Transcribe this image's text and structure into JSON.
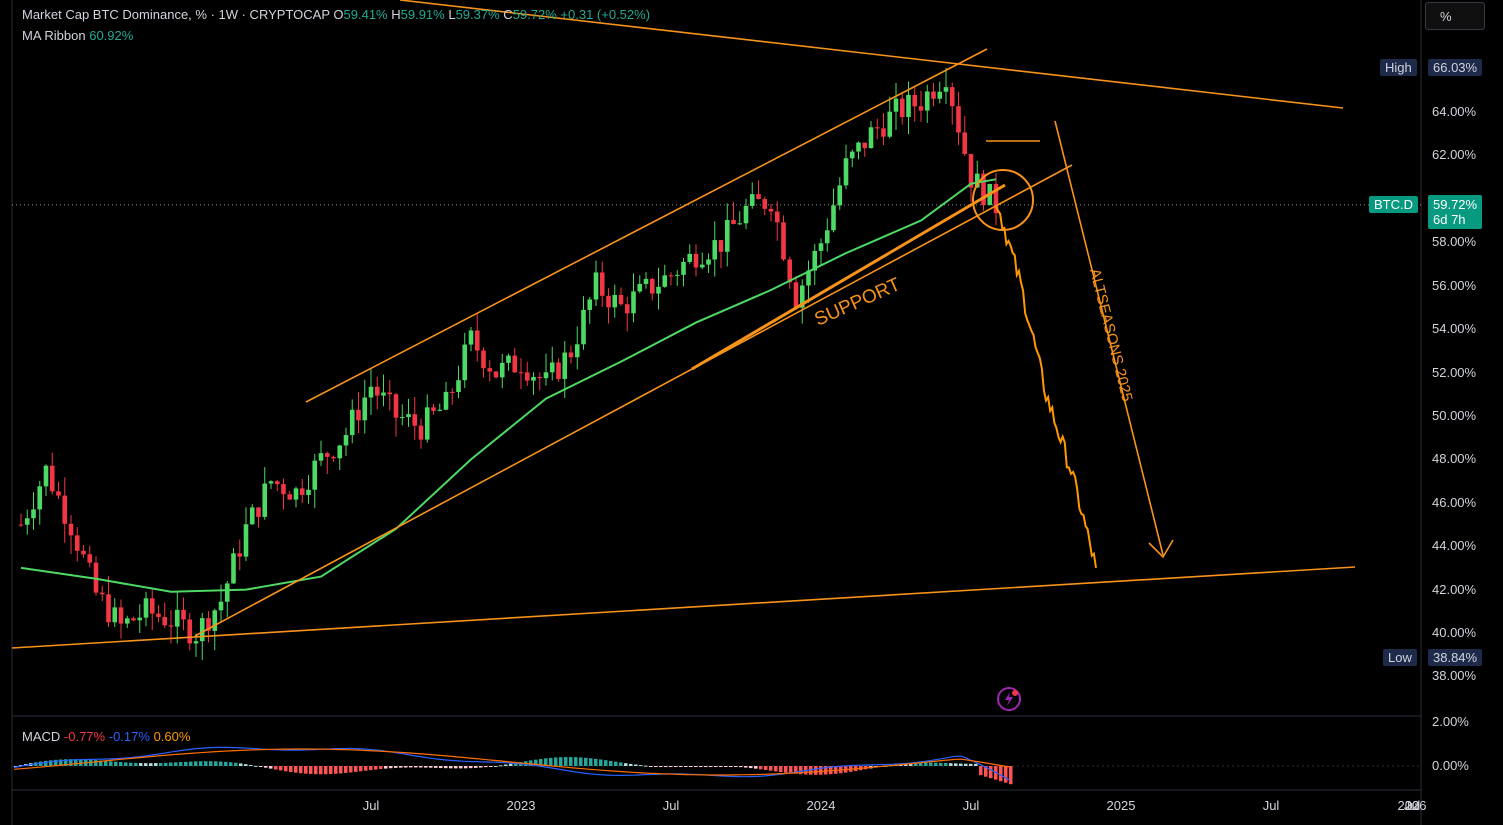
{
  "legend": {
    "title": "Market Cap BTC Dominance, % · 1W · CRYPTOCAP",
    "o_label": "O",
    "o_value": "59.41%",
    "h_label": "H",
    "h_value": "59.91%",
    "l_label": "L",
    "l_value": "59.37%",
    "c_label": "C",
    "c_value": "59.72%",
    "change": "+0.31 (+0.52%)",
    "ma_label": "MA Ribbon",
    "ma_value": "60.92%"
  },
  "scale_button": "%",
  "price_tags": {
    "high_label": "High",
    "high_value": "66.03%",
    "low_label": "Low",
    "low_value": "38.84%",
    "symbol": "BTC.D",
    "last_value": "59.72%",
    "countdown": "6d 7h"
  },
  "annotations": {
    "support": "SUPPORT",
    "altseasons": "ALTSEASONS 2025"
  },
  "macd": {
    "label": "MACD",
    "v1": "-0.77%",
    "v2": "-0.17%",
    "v3": "0.60%"
  },
  "y_ticks": [
    "64.00%",
    "62.00%",
    "58.00%",
    "56.00%",
    "54.00%",
    "52.00%",
    "50.00%",
    "48.00%",
    "46.00%",
    "44.00%",
    "42.00%",
    "40.00%",
    "38.00%"
  ],
  "macd_ticks": [
    "2.00%",
    "0.00%"
  ],
  "x_ticks": [
    "Jul",
    "2023",
    "Jul",
    "2024",
    "Jul",
    "2025",
    "Jul",
    "2026",
    "Jul",
    "20"
  ],
  "colors": {
    "up": "#4cd964",
    "down": "#f23645",
    "ma": "#4cd964",
    "lines": "#f7931a",
    "projection": "#ff9800",
    "macd_line": "#2962ff",
    "signal_line": "#ff6d00"
  },
  "chart_data": {
    "type": "candlestick",
    "title": "Market Cap BTC Dominance, % · 1W · CRYPTOCAP",
    "ylim": [
      37,
      67.5
    ],
    "x_range": [
      "2022-05",
      "2026-12"
    ],
    "series": [
      {
        "name": "BTC.D",
        "kind": "weekly-close-approx",
        "x": [
          "2022-05",
          "2022-06",
          "2022-07",
          "2022-08",
          "2022-09",
          "2022-10",
          "2022-11",
          "2022-12",
          "2023-01",
          "2023-02",
          "2023-03",
          "2023-04",
          "2023-05",
          "2023-06",
          "2023-07",
          "2023-08",
          "2023-09",
          "2023-10",
          "2023-11",
          "2023-12",
          "2024-01",
          "2024-02",
          "2024-03",
          "2024-04",
          "2024-05",
          "2024-06",
          "2024-07",
          "2024-08",
          "2024-09",
          "2024-10",
          "2024-11",
          "2024-12",
          "2025-01",
          "2025-02",
          "2025-03",
          "2025-04",
          "2025-05",
          "2025-06",
          "2025-07",
          "2025-08"
        ],
        "values": [
          45.0,
          47.5,
          45.0,
          41.8,
          40.3,
          41.0,
          40.6,
          40.0,
          41.5,
          44.8,
          47.0,
          46.5,
          48.0,
          49.2,
          51.4,
          50.0,
          49.5,
          50.5,
          53.5,
          52.0,
          52.5,
          51.5,
          53.0,
          56.0,
          55.0,
          55.8,
          56.5,
          57.5,
          58.0,
          59.5,
          60.0,
          55.5,
          58.0,
          61.5,
          63.0,
          64.0,
          64.5,
          65.8,
          61.0,
          59.7
        ]
      },
      {
        "name": "MA Ribbon",
        "x": [
          "2022-05",
          "2022-08",
          "2022-11",
          "2023-02",
          "2023-05",
          "2023-08",
          "2023-11",
          "2024-02",
          "2024-05",
          "2024-08",
          "2024-11",
          "2025-02",
          "2025-05",
          "2025-07",
          "2025-08"
        ],
        "values": [
          43.0,
          42.5,
          41.9,
          42.0,
          42.6,
          44.8,
          48.0,
          50.8,
          52.5,
          54.3,
          55.8,
          57.5,
          59.0,
          60.7,
          60.9
        ]
      },
      {
        "name": "Projection",
        "x": [
          "2025-08",
          "2025-09",
          "2025-10",
          "2025-11",
          "2025-12"
        ],
        "values": [
          60.0,
          56.0,
          51.0,
          47.5,
          43.0
        ]
      }
    ]
  }
}
